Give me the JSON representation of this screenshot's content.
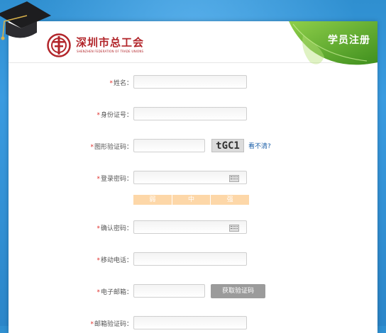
{
  "header": {
    "org_name_cn": "深圳市总工会",
    "org_name_en": "SHENZHEN FEDERATION OF TRADE UNIONS",
    "page_title": "学员注册"
  },
  "colors": {
    "brand_red": "#b2252a",
    "required_star": "#e0302c",
    "background_blue": "#2f8fd0",
    "strength_bar": "#fdd7a8",
    "button_gray": "#9b9b9b",
    "link_blue": "#1b5fa8"
  },
  "form": {
    "required_mark": "*",
    "fields": {
      "name": {
        "label": "姓名：",
        "value": ""
      },
      "id_number": {
        "label": "身份证号：",
        "value": ""
      },
      "image_captcha": {
        "label": "图形验证码：",
        "value": "",
        "captcha_text": "tGC1",
        "refresh_link": "看不清?"
      },
      "password": {
        "label": "登录密码：",
        "value": "",
        "icon": "keyboard-icon"
      },
      "password_strength": {
        "levels": [
          "弱",
          "中",
          "强"
        ]
      },
      "confirm_password": {
        "label": "确认密码：",
        "value": "",
        "icon": "keyboard-icon"
      },
      "mobile": {
        "label": "移动电话：",
        "value": ""
      },
      "email": {
        "label": "电子邮箱：",
        "value": "",
        "button": "获取验证码"
      },
      "email_code": {
        "label": "邮箱验证码：",
        "value": ""
      }
    }
  }
}
